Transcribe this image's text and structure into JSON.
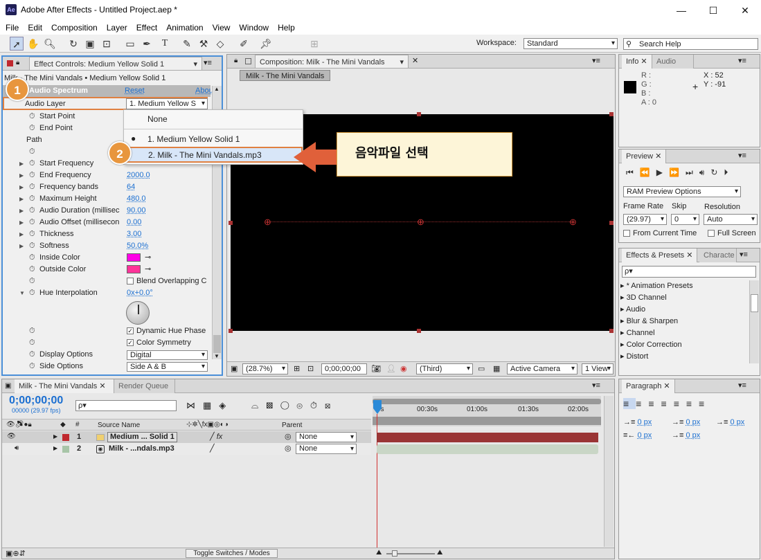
{
  "app": {
    "title": "Adobe After Effects - Untitled Project.aep *",
    "logo": "Ae"
  },
  "menu": [
    "File",
    "Edit",
    "Composition",
    "Layer",
    "Effect",
    "Animation",
    "View",
    "Window",
    "Help"
  ],
  "toolbar": {
    "workspace_label": "Workspace:",
    "workspace_value": "Standard",
    "search_placeholder": "Search Help"
  },
  "effect_controls": {
    "tab": "Effect Controls: Medium Yellow Solid 1",
    "path": "Milk - The Mini Vandals • Medium Yellow Solid 1",
    "effect_name": "Audio Spectrum",
    "reset": "Reset",
    "about": "Abou",
    "audio_layer_label": "Audio Layer",
    "audio_layer_value": "1. Medium Yellow S",
    "rows": [
      {
        "label": "Start Point",
        "val": ""
      },
      {
        "label": "End Point",
        "val": ""
      },
      {
        "label": "Path",
        "val": ""
      },
      {
        "label": "",
        "val": ""
      },
      {
        "label": "Start Frequency",
        "val": ""
      },
      {
        "label": "End Frequency",
        "val": "2000.0"
      },
      {
        "label": "Frequency bands",
        "val": "64"
      },
      {
        "label": "Maximum Height",
        "val": "480.0"
      },
      {
        "label": "Audio Duration (millisec",
        "val": "90.00"
      },
      {
        "label": "Audio Offset (millisecon",
        "val": "0.00"
      },
      {
        "label": "Thickness",
        "val": "3.00"
      },
      {
        "label": "Softness",
        "val": "50.0%"
      },
      {
        "label": "Inside Color",
        "val": ""
      },
      {
        "label": "Outside Color",
        "val": ""
      },
      {
        "label": "",
        "val": ""
      },
      {
        "label": "Hue Interpolation",
        "val": "0x+0.0°"
      }
    ],
    "blend_overlapping": "Blend Overlapping C",
    "dynamic_hue": "Dynamic Hue Phase",
    "color_symmetry": "Color Symmetry",
    "display_options_label": "Display Options",
    "display_options_value": "Digital",
    "side_options_label": "Side Options",
    "side_options_value": "Side A & B",
    "inside_color": "#ff00e6",
    "outside_color": "#ff3399"
  },
  "popup": {
    "items": [
      "None",
      "1. Medium Yellow Solid 1",
      "2. Milk - The Mini Vandals.mp3"
    ]
  },
  "annotation": {
    "badge1": "1",
    "badge2": "2",
    "callout": "음악파일 선택"
  },
  "composition": {
    "tab": "Composition: Milk - The Mini Vandals",
    "sub_tab": "Milk - The Mini Vandals",
    "zoom": "(28.7%)",
    "timecode": "0;00;00;00",
    "view": "(Third)",
    "camera": "Active Camera",
    "views": "1 View"
  },
  "info": {
    "tab_info": "Info",
    "tab_audio": "Audio",
    "r": "R :",
    "g": "G :",
    "b": "B :",
    "a": "A : 0",
    "x": "X : 52",
    "y": "Y : -91"
  },
  "preview": {
    "tab": "Preview",
    "ram": "RAM Preview Options",
    "frame_rate_label": "Frame Rate",
    "skip_label": "Skip",
    "resolution_label": "Resolution",
    "frame_rate": "(29.97)",
    "skip": "0",
    "resolution": "Auto",
    "from_current": "From Current Time",
    "full_screen": "Full Screen"
  },
  "effects_presets": {
    "tab": "Effects & Presets",
    "tab2": "Characte",
    "search_placeholder": "ρ▾",
    "items": [
      "* Animation Presets",
      "3D Channel",
      "Audio",
      "Blur & Sharpen",
      "Channel",
      "Color Correction",
      "Distort"
    ]
  },
  "timeline": {
    "tab": "Milk - The Mini Vandals",
    "tab2": "Render Queue",
    "timecode": "0;00;00;00",
    "fps": "00000 (29.97 fps)",
    "source_name": "Source Name",
    "parent": "Parent",
    "layers": [
      {
        "num": "1",
        "name": "Medium ... Solid 1",
        "color": "#c0282e",
        "parent": "None"
      },
      {
        "num": "2",
        "name": "Milk - ...ndals.mp3",
        "color": "#a8c5a8",
        "parent": "None"
      }
    ],
    "ruler": [
      "0s",
      "00:30s",
      "01:00s",
      "01:30s",
      "02:00s"
    ],
    "toggle": "Toggle Switches / Modes"
  },
  "paragraph": {
    "tab": "Paragraph",
    "v1": "0 px",
    "v2": "0 px",
    "v3": "0 px",
    "v4": "0 px",
    "v5": "0 px"
  }
}
